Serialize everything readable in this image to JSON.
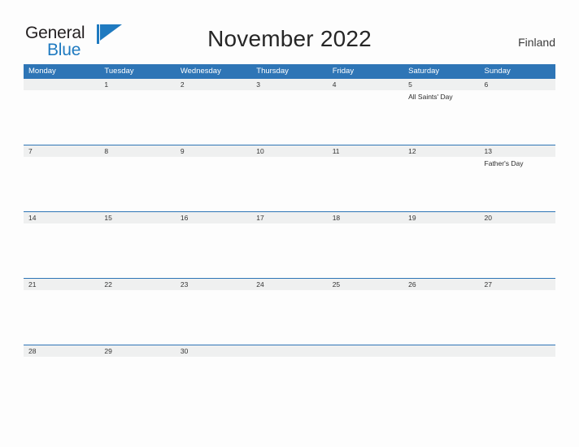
{
  "brand": {
    "name_part1": "General",
    "name_part2": "Blue",
    "flag_icon": "blue-flag-triangle-icon",
    "accent_color": "#1f7ac0"
  },
  "header": {
    "title": "November 2022",
    "region": "Finland"
  },
  "theme": {
    "header_blue": "#2e75b6",
    "number_row_gray": "#eff0f0",
    "page_background": "#fdfdfd",
    "text_color": "#333333"
  },
  "calendar": {
    "month": "November",
    "year": "2022",
    "weekday_headers": [
      "Monday",
      "Tuesday",
      "Wednesday",
      "Thursday",
      "Friday",
      "Saturday",
      "Sunday"
    ],
    "weeks": [
      {
        "days": [
          {
            "number": "",
            "event": ""
          },
          {
            "number": "1",
            "event": ""
          },
          {
            "number": "2",
            "event": ""
          },
          {
            "number": "3",
            "event": ""
          },
          {
            "number": "4",
            "event": ""
          },
          {
            "number": "5",
            "event": "All Saints' Day"
          },
          {
            "number": "6",
            "event": ""
          }
        ]
      },
      {
        "days": [
          {
            "number": "7",
            "event": ""
          },
          {
            "number": "8",
            "event": ""
          },
          {
            "number": "9",
            "event": ""
          },
          {
            "number": "10",
            "event": ""
          },
          {
            "number": "11",
            "event": ""
          },
          {
            "number": "12",
            "event": ""
          },
          {
            "number": "13",
            "event": "Father's Day"
          }
        ]
      },
      {
        "days": [
          {
            "number": "14",
            "event": ""
          },
          {
            "number": "15",
            "event": ""
          },
          {
            "number": "16",
            "event": ""
          },
          {
            "number": "17",
            "event": ""
          },
          {
            "number": "18",
            "event": ""
          },
          {
            "number": "19",
            "event": ""
          },
          {
            "number": "20",
            "event": ""
          }
        ]
      },
      {
        "days": [
          {
            "number": "21",
            "event": ""
          },
          {
            "number": "22",
            "event": ""
          },
          {
            "number": "23",
            "event": ""
          },
          {
            "number": "24",
            "event": ""
          },
          {
            "number": "25",
            "event": ""
          },
          {
            "number": "26",
            "event": ""
          },
          {
            "number": "27",
            "event": ""
          }
        ]
      },
      {
        "days": [
          {
            "number": "28",
            "event": ""
          },
          {
            "number": "29",
            "event": ""
          },
          {
            "number": "30",
            "event": ""
          },
          {
            "number": "",
            "event": ""
          },
          {
            "number": "",
            "event": ""
          },
          {
            "number": "",
            "event": ""
          },
          {
            "number": "",
            "event": ""
          }
        ]
      }
    ]
  }
}
